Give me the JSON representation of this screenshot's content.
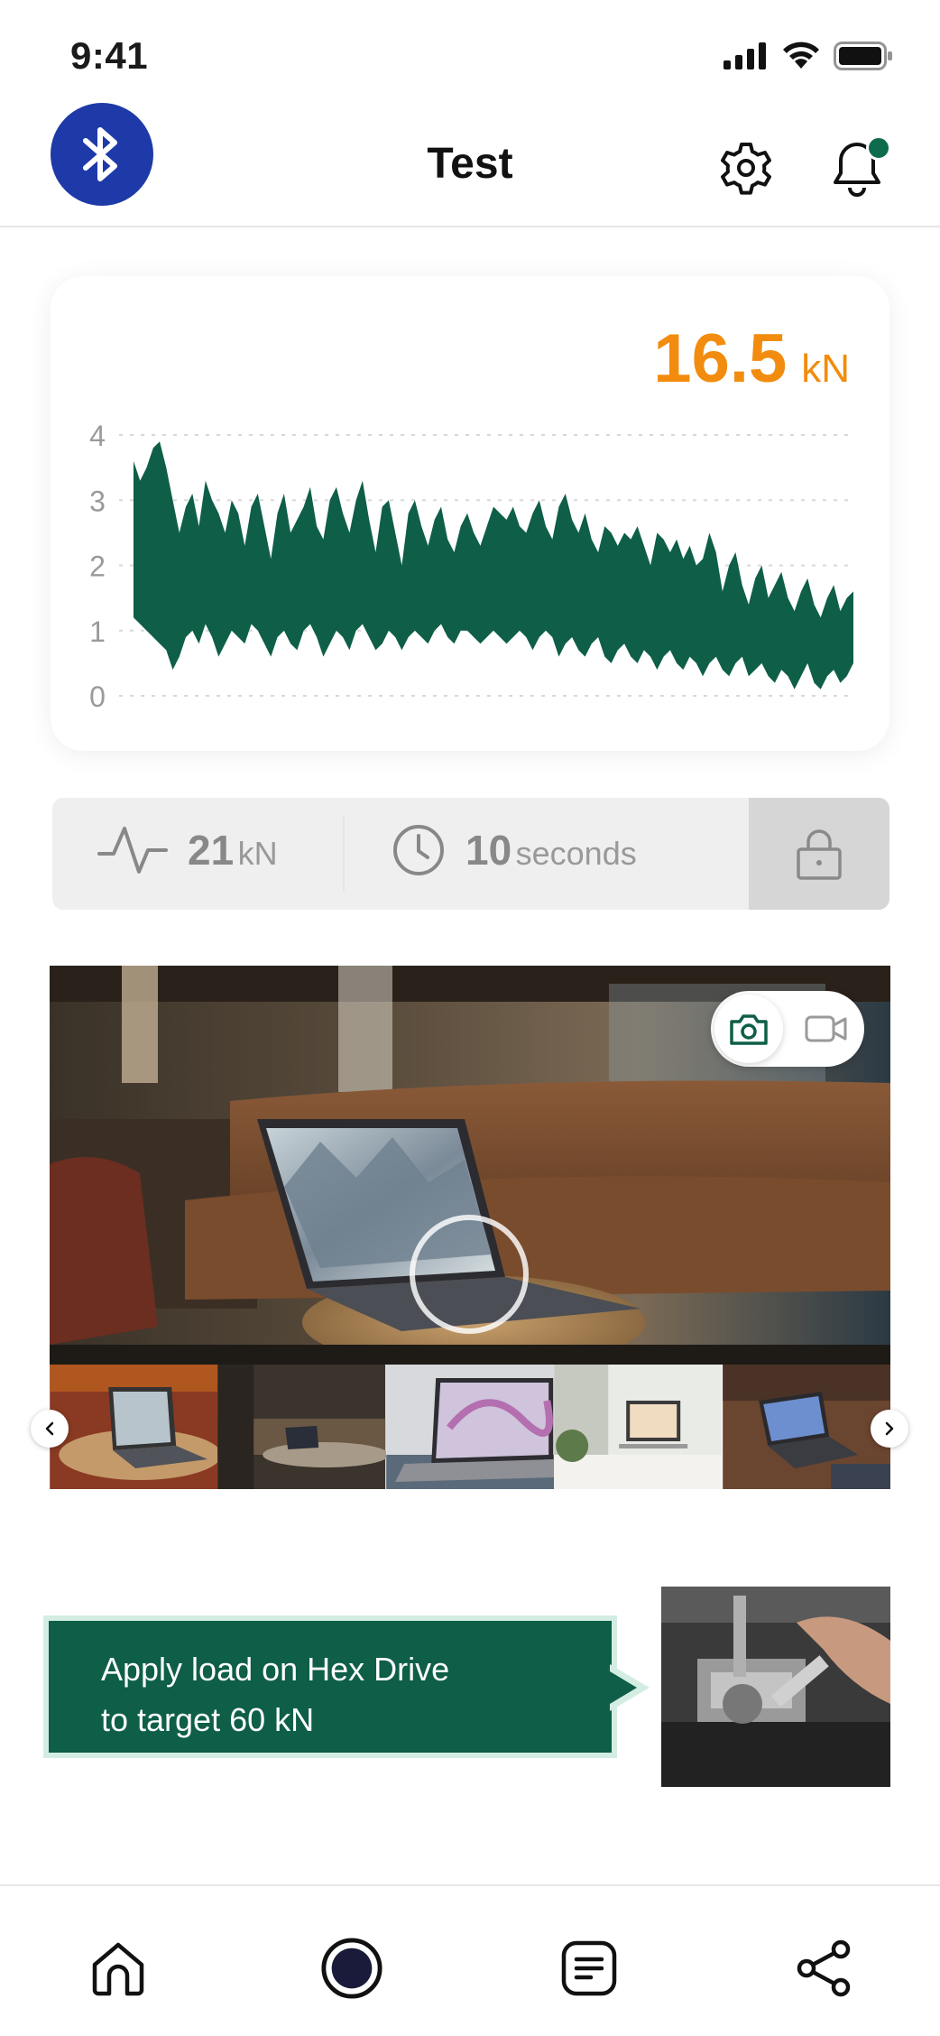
{
  "status_bar": {
    "time": "9:41"
  },
  "header": {
    "title": "Test",
    "icons": {
      "bluetooth": "bluetooth-icon",
      "settings": "gear-icon",
      "notifications": "bell-icon"
    },
    "bluetooth_color": "#1e3aa8",
    "notification_badge": true
  },
  "reading": {
    "value": "16.5",
    "unit": "kN",
    "color": "#f28c0f"
  },
  "chart_data": {
    "type": "area",
    "title": "",
    "xlabel": "",
    "ylabel": "",
    "ylim": [
      0,
      4
    ],
    "yticks": [
      "0",
      "1",
      "2",
      "3",
      "4"
    ],
    "grid": true,
    "color": "#0e5e48",
    "series": [
      {
        "upper": [
          3.6,
          3.3,
          3.5,
          3.8,
          3.9,
          3.5,
          3.0,
          2.5,
          2.9,
          3.1,
          2.6,
          3.3,
          3.0,
          2.8,
          2.5,
          3.0,
          2.8,
          2.3,
          2.9,
          3.1,
          2.6,
          2.1,
          2.8,
          3.1,
          2.5,
          2.7,
          2.9,
          3.2,
          2.6,
          2.4,
          3.0,
          3.2,
          2.8,
          2.5,
          3.0,
          3.3,
          2.7,
          2.2,
          2.9,
          3.0,
          2.5,
          2.0,
          2.8,
          3.0,
          2.6,
          2.3,
          2.7,
          2.9,
          2.4,
          2.2,
          2.6,
          2.8,
          2.5,
          2.3,
          2.6,
          2.9,
          2.8,
          2.7,
          2.9,
          2.6,
          2.5,
          2.8,
          3.0,
          2.6,
          2.4,
          2.9,
          3.1,
          2.7,
          2.5,
          2.8,
          2.4,
          2.2,
          2.6,
          2.5,
          2.3,
          2.5,
          2.4,
          2.6,
          2.3,
          2.0,
          2.5,
          2.4,
          2.2,
          2.4,
          2.1,
          2.3,
          2.0,
          2.1,
          2.5,
          2.2,
          1.6,
          2.0,
          2.2,
          1.7,
          1.4,
          1.8,
          2.0,
          1.5,
          1.7,
          1.9,
          1.5,
          1.3,
          1.6,
          1.8,
          1.4,
          1.2,
          1.5,
          1.7,
          1.3,
          1.5,
          1.6
        ],
        "lower": [
          1.2,
          1.1,
          1.0,
          0.9,
          0.8,
          0.7,
          0.4,
          0.6,
          0.9,
          1.0,
          0.8,
          1.1,
          0.9,
          0.6,
          0.8,
          1.0,
          0.9,
          0.8,
          1.1,
          1.0,
          0.8,
          0.6,
          0.9,
          1.0,
          0.8,
          0.7,
          1.0,
          1.1,
          0.9,
          0.6,
          0.8,
          1.0,
          0.9,
          0.7,
          1.0,
          1.1,
          0.9,
          0.7,
          0.8,
          1.0,
          0.9,
          0.7,
          0.9,
          1.0,
          0.9,
          0.8,
          1.0,
          1.1,
          0.9,
          0.8,
          1.0,
          1.0,
          0.9,
          0.8,
          0.9,
          1.0,
          0.9,
          0.8,
          0.9,
          1.0,
          0.9,
          0.7,
          0.9,
          1.0,
          0.9,
          0.6,
          0.8,
          0.9,
          0.7,
          0.6,
          0.8,
          0.9,
          0.6,
          0.5,
          0.7,
          0.8,
          0.6,
          0.5,
          0.7,
          0.6,
          0.4,
          0.6,
          0.7,
          0.5,
          0.4,
          0.6,
          0.5,
          0.3,
          0.5,
          0.6,
          0.4,
          0.3,
          0.5,
          0.6,
          0.3,
          0.4,
          0.5,
          0.3,
          0.2,
          0.4,
          0.3,
          0.1,
          0.3,
          0.5,
          0.2,
          0.1,
          0.3,
          0.4,
          0.2,
          0.3,
          0.5
        ]
      }
    ]
  },
  "stats": {
    "force_value": "21",
    "force_unit": "kN",
    "time_value": "10",
    "time_unit": "seconds",
    "icons": {
      "force": "pulse-icon",
      "time": "clock-icon",
      "lock": "lock-icon"
    }
  },
  "media": {
    "mode_options": [
      "photo",
      "video"
    ],
    "selected_mode": "photo",
    "icons": {
      "photo": "camera-icon",
      "video": "video-camera-icon",
      "prev": "chevron-left-icon",
      "next": "chevron-right-icon"
    },
    "thumbnail_count": 5
  },
  "instruction": {
    "line1": "Apply load on Hex Drive",
    "line2": "to target 60 kN",
    "color": "#0e5e48"
  },
  "bottom_nav": {
    "items": [
      "home-icon",
      "record-icon",
      "notes-icon",
      "share-icon"
    ]
  }
}
